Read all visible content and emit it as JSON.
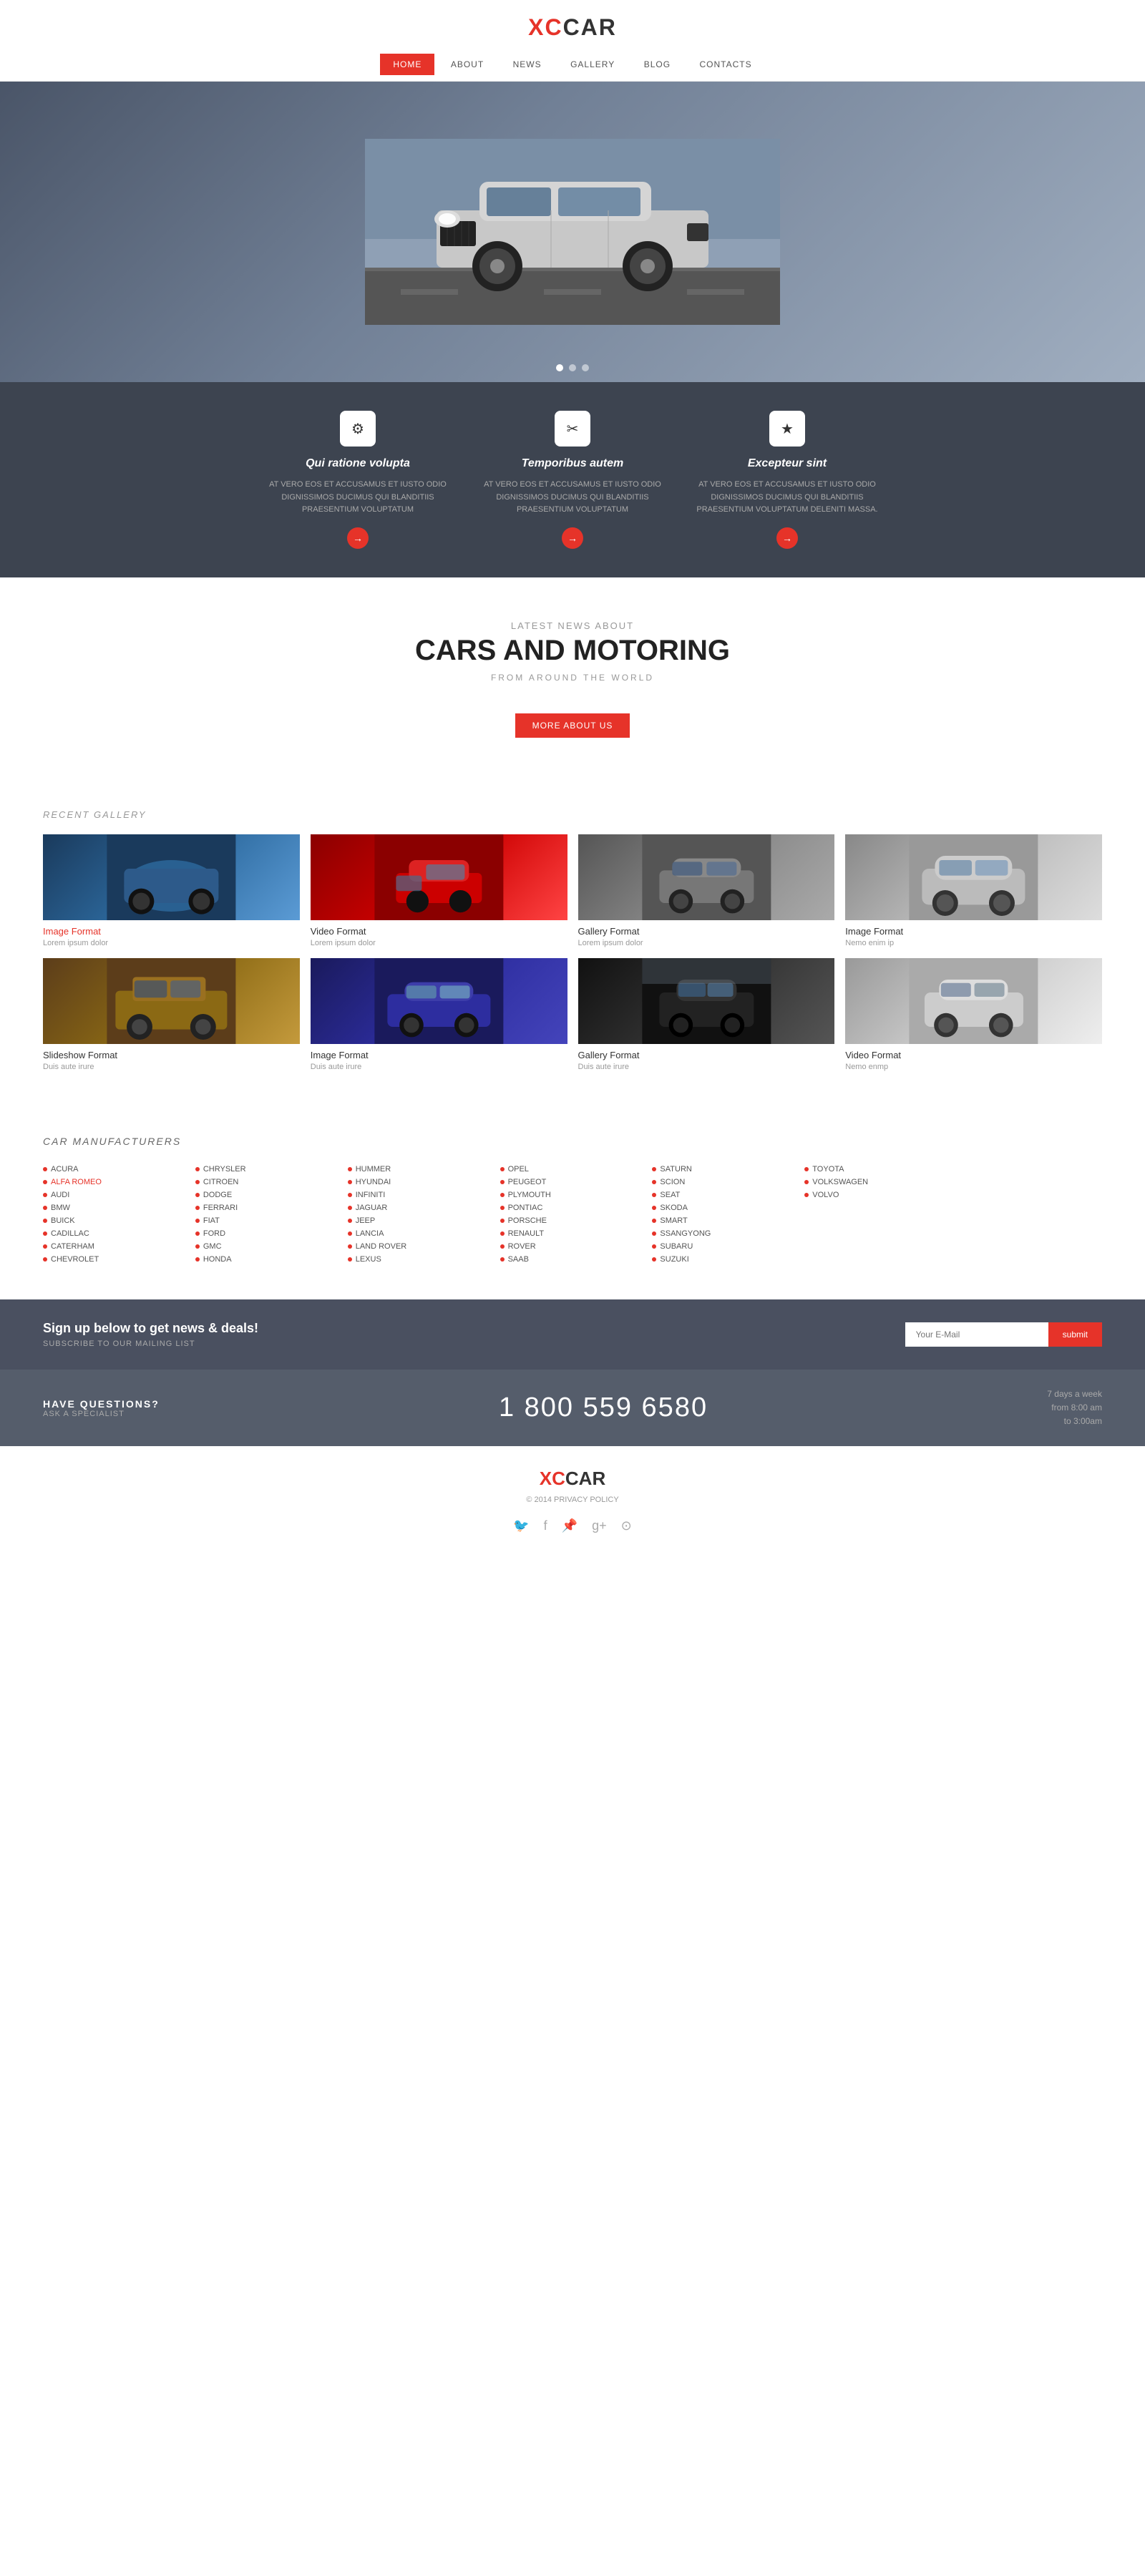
{
  "header": {
    "logo_xc": "XC",
    "logo_car": "CAR"
  },
  "nav": {
    "items": [
      {
        "label": "HOME",
        "active": true
      },
      {
        "label": "ABOUT",
        "active": false
      },
      {
        "label": "NEWS",
        "active": false
      },
      {
        "label": "GALLERY",
        "active": false
      },
      {
        "label": "BLOG",
        "active": false
      },
      {
        "label": "CONTACTS",
        "active": false
      }
    ]
  },
  "features": {
    "items": [
      {
        "icon": "⚙",
        "title": "Qui ratione volupta",
        "desc": "AT VERO EOS ET ACCUSAMUS ET IUSTO ODIO DIGNISSIMOS DUCIMUS QUI BLANDITIIS PRAESENTIUM VOLUPTATUM"
      },
      {
        "icon": "✂",
        "title": "Temporibus autem",
        "desc": "AT VERO EOS ET ACCUSAMUS ET IUSTO ODIO DIGNISSIMOS DUCIMUS QUI BLANDITIIS PRAESENTIUM VOLUPTATUM"
      },
      {
        "icon": "★",
        "title": "Excepteur sint",
        "desc": "AT VERO EOS ET ACCUSAMUS ET IUSTO ODIO DIGNISSIMOS DUCIMUS QUI BLANDITIIS PRAESENTIUM VOLUPTATUM DELENITI MASSA."
      }
    ]
  },
  "news": {
    "label": "LATEST NEWS ABOUT",
    "title": "CARS AND MOTORING",
    "subtitle": "FROM AROUND THE WORLD",
    "button": "MORE ABOUT US"
  },
  "gallery": {
    "section_label": "RECENT GALLERY",
    "items": [
      {
        "title": "Image Format",
        "caption": "Lorem ipsum dolor",
        "red": true,
        "thumb": "thumb-blue"
      },
      {
        "title": "Video Format",
        "caption": "Lorem ipsum dolor",
        "red": false,
        "thumb": "thumb-red"
      },
      {
        "title": "Gallery Format",
        "caption": "Lorem ipsum dolor",
        "red": false,
        "thumb": "thumb-gray"
      },
      {
        "title": "Image Format",
        "caption": "Nemo enim ip",
        "red": false,
        "thumb": "thumb-silver"
      },
      {
        "title": "Slideshow Format",
        "caption": "Duis aute irure",
        "red": false,
        "thumb": "thumb-brown"
      },
      {
        "title": "Image Format",
        "caption": "Duis aute irure",
        "red": false,
        "thumb": "thumb-darkblue"
      },
      {
        "title": "Gallery Format",
        "caption": "Duis aute irure",
        "red": false,
        "thumb": "thumb-black"
      },
      {
        "title": "Video Format",
        "caption": "Nemo enmp",
        "red": false,
        "thumb": "thumb-lightgray"
      }
    ]
  },
  "manufacturers": {
    "title": "CAR MANUFACTURERS",
    "columns": [
      [
        "ACURA",
        "ALFA ROMEO",
        "AUDI",
        "BMW",
        "BUICK",
        "CADILLAC",
        "CATERHAM",
        "CHEVROLET"
      ],
      [
        "CHRYSLER",
        "CITROEN",
        "DODGE",
        "FERRARI",
        "FIAT",
        "FORD",
        "GMC",
        "HONDA"
      ],
      [
        "HUMMER",
        "HYUNDAI",
        "INFINITI",
        "JAGUAR",
        "JEEP",
        "LANCIA",
        "LAND ROVER",
        "LEXUS"
      ],
      [
        "OPEL",
        "PEUGEOT",
        "PLYMOUTH",
        "PONTIAC",
        "PORSCHE",
        "RENAULT",
        "ROVER",
        "SAAB"
      ],
      [
        "SATURN",
        "SCION",
        "SEAT",
        "SKODA",
        "SMART",
        "SSANGYONG",
        "SUBARU",
        "SUZUKI"
      ],
      [
        "TOYOTA",
        "VOLKSWAGEN",
        "VOLVO",
        "",
        "",
        "",
        "",
        ""
      ],
      [
        "",
        "",
        "",
        "",
        "",
        "",
        "",
        ""
      ]
    ]
  },
  "newsletter": {
    "title": "Sign up below to get news & deals!",
    "subtitle": "SUBSCRIBE TO OUR MAILING LIST",
    "input_placeholder": "Your E-Mail",
    "button": "submit"
  },
  "contact": {
    "label1": "HAVE QUESTIONS?",
    "label2": "ASK A SPECIALIST",
    "phone": "1 800 559 6580",
    "hours": "7 days a week\nfrom 8:00 am\nto 3:00am"
  },
  "footer": {
    "logo_xc": "XC",
    "logo_car": "CAR",
    "copy": "© 2014  PRIVACY POLICY",
    "social": [
      "twitter",
      "facebook",
      "pinterest",
      "google-plus",
      "github"
    ]
  }
}
